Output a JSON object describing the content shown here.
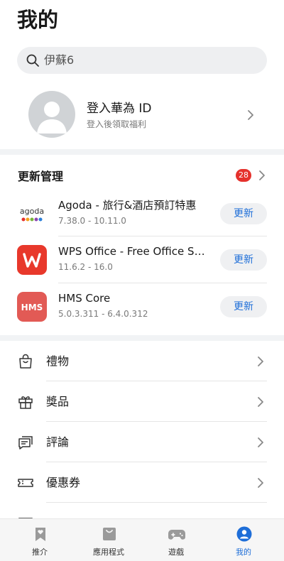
{
  "page": {
    "title": "我的"
  },
  "search": {
    "placeholder": "伊蘇6"
  },
  "account": {
    "title": "登入華為 ID",
    "subtitle": "登入後領取福利"
  },
  "updates": {
    "heading": "更新管理",
    "badge_count": "28",
    "apps": [
      {
        "name": "Agoda - 旅行&酒店預訂特惠",
        "version": "7.38.0 - 10.11.0",
        "icon": "agoda-logo",
        "button": "更新"
      },
      {
        "name": "WPS Office - Free Office Suit for...",
        "version": "11.6.2 - 16.0",
        "icon": "wps-office-logo",
        "button": "更新"
      },
      {
        "name": "HMS Core",
        "version": "5.0.3.311 - 6.4.0.312",
        "icon": "hms-core-logo",
        "button": "更新"
      }
    ]
  },
  "menu": {
    "items": [
      {
        "label": "禮物",
        "icon": "gift-bag-icon"
      },
      {
        "label": "獎品",
        "icon": "gift-box-icon"
      },
      {
        "label": "評論",
        "icon": "comment-icon"
      },
      {
        "label": "優惠券",
        "icon": "coupon-icon"
      }
    ]
  },
  "bottom_nav": {
    "tabs": [
      {
        "label": "推介",
        "icon": "bookmark-heart-icon",
        "active": false
      },
      {
        "label": "應用程式",
        "icon": "shopping-bag-icon",
        "active": false
      },
      {
        "label": "遊戲",
        "icon": "gamepad-icon",
        "active": false
      },
      {
        "label": "我的",
        "icon": "person-icon",
        "active": true
      }
    ]
  },
  "colors": {
    "accent": "#1e6ed8",
    "badge": "#e5312c",
    "wps": "#e8382b",
    "hms": "#e25a55"
  }
}
